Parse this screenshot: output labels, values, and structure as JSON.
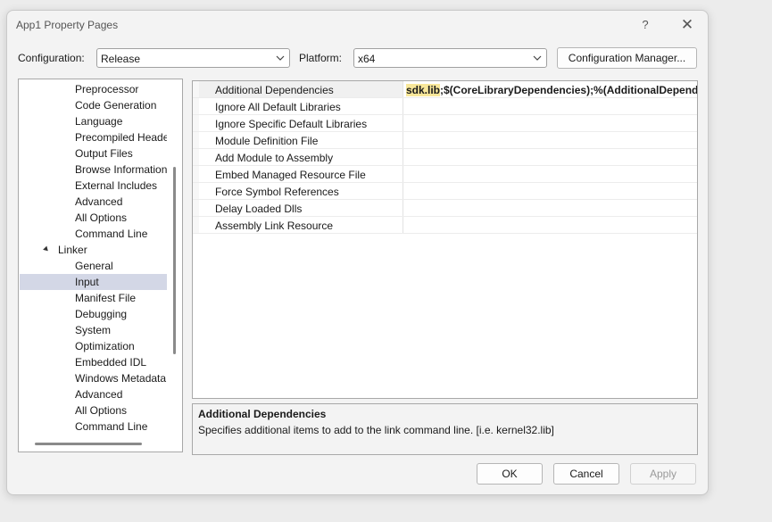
{
  "window": {
    "title": "App1 Property Pages",
    "help_glyph": "?",
    "close_glyph": "✕"
  },
  "config_bar": {
    "configuration_label": "Configuration:",
    "configuration_value": "Release",
    "platform_label": "Platform:",
    "platform_value": "x64",
    "manager_button": "Configuration Manager..."
  },
  "tree": {
    "items": [
      {
        "label": "Preprocessor"
      },
      {
        "label": "Code Generation"
      },
      {
        "label": "Language"
      },
      {
        "label": "Precompiled Heade"
      },
      {
        "label": "Output Files"
      },
      {
        "label": "Browse Information"
      },
      {
        "label": "External Includes"
      },
      {
        "label": "Advanced"
      },
      {
        "label": "All Options"
      },
      {
        "label": "Command Line"
      },
      {
        "label": "Linker"
      },
      {
        "label": "General"
      },
      {
        "label": "Input"
      },
      {
        "label": "Manifest File"
      },
      {
        "label": "Debugging"
      },
      {
        "label": "System"
      },
      {
        "label": "Optimization"
      },
      {
        "label": "Embedded IDL"
      },
      {
        "label": "Windows Metadata"
      },
      {
        "label": "Advanced"
      },
      {
        "label": "All Options"
      },
      {
        "label": "Command Line"
      }
    ],
    "selected": "Input"
  },
  "grid": {
    "rows": [
      {
        "name": "Additional Dependencies",
        "value_highlight": "sdk.lib",
        "value_rest": ";$(CoreLibraryDependencies);%(AdditionalDependen"
      },
      {
        "name": "Ignore All Default Libraries",
        "value_highlight": "",
        "value_rest": ""
      },
      {
        "name": "Ignore Specific Default Libraries",
        "value_highlight": "",
        "value_rest": ""
      },
      {
        "name": "Module Definition File",
        "value_highlight": "",
        "value_rest": ""
      },
      {
        "name": "Add Module to Assembly",
        "value_highlight": "",
        "value_rest": ""
      },
      {
        "name": "Embed Managed Resource File",
        "value_highlight": "",
        "value_rest": ""
      },
      {
        "name": "Force Symbol References",
        "value_highlight": "",
        "value_rest": ""
      },
      {
        "name": "Delay Loaded Dlls",
        "value_highlight": "",
        "value_rest": ""
      },
      {
        "name": "Assembly Link Resource",
        "value_highlight": "",
        "value_rest": ""
      }
    ]
  },
  "description": {
    "title": "Additional Dependencies",
    "text": "Specifies additional items to add to the link command line. [i.e. kernel32.lib]"
  },
  "buttons": {
    "ok": "OK",
    "cancel": "Cancel",
    "apply": "Apply"
  },
  "colors": {
    "selection": "#d3d7e6",
    "highlight": "#f8e79a"
  }
}
